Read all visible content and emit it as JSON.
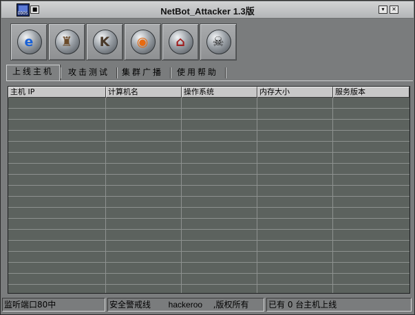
{
  "window": {
    "title": "NetBot_Attacker 1.3版",
    "app_icon_text": "DDOS",
    "minimize_glyph": "▾",
    "close_glyph": "✕"
  },
  "toolbar": {
    "buttons": [
      {
        "icon": "internet-explorer-icon",
        "glyph": "e",
        "color": "#1b62d6"
      },
      {
        "icon": "knight-helmet-icon",
        "glyph": "♜",
        "color": "#6b4b2a"
      },
      {
        "icon": "k-emblem-icon",
        "glyph": "K",
        "color": "#4a3a2a"
      },
      {
        "icon": "blender-logo-icon",
        "glyph": "◉",
        "color": "#e86a10"
      },
      {
        "icon": "home-icon",
        "glyph": "⌂",
        "color": "#a02020"
      },
      {
        "icon": "skull-crossbones-icon",
        "glyph": "☠",
        "color": "#111111"
      }
    ]
  },
  "tabs": [
    {
      "label": "上线主机",
      "active": true
    },
    {
      "label": "攻击测试",
      "active": false
    },
    {
      "label": "集群广播",
      "active": false
    },
    {
      "label": "使用帮助",
      "active": false
    }
  ],
  "table": {
    "columns": [
      "主机 IP",
      "计算机名",
      "操作系统",
      "内存大小",
      "服务版本"
    ],
    "empty_rows": 18
  },
  "status_bar": {
    "port": "监听端口80中",
    "security": "安全警戒线",
    "author": "hackeroo",
    "copyright": ",版权所有",
    "online": "已有 0 台主机上线"
  },
  "colors": {
    "table_bg": "#5c625e",
    "window_bg": "#7a7c7d",
    "header_bg": "#c8c8c8"
  }
}
